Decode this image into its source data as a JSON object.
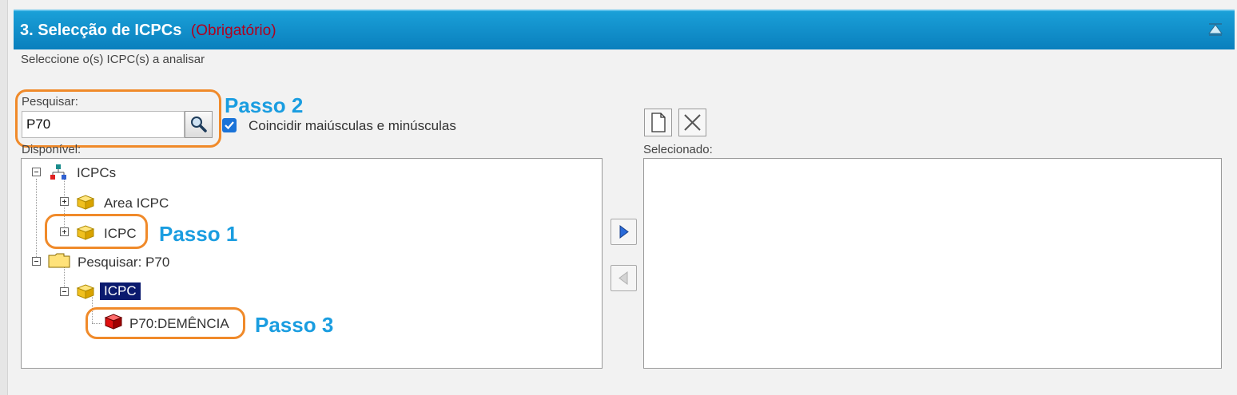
{
  "section": {
    "number": "3.",
    "title": "Selecção de ICPCs",
    "required": "(Obrigatório)",
    "subtitle": "Seleccione o(s) ICPC(s) a analisar"
  },
  "search": {
    "label": "Pesquisar:",
    "value": "P70",
    "match_case_label": "Coincidir maiúsculas e minúsculas",
    "match_case_checked": true
  },
  "available": {
    "label": "Disponível:",
    "tree": [
      {
        "label": "ICPCs",
        "icon": "org-chart-icon"
      },
      {
        "label": "Area ICPC",
        "icon": "cube-icon"
      },
      {
        "label": "ICPC",
        "icon": "cube-icon"
      },
      {
        "label": "Pesquisar: P70",
        "icon": "folder-icon"
      },
      {
        "label": "ICPC",
        "icon": "cube-icon",
        "selected": true
      },
      {
        "label": "P70:DEMÊNCIA",
        "icon": "red-cube-icon"
      }
    ]
  },
  "selected": {
    "label": "Selecionado:"
  },
  "annotations": {
    "step1": "Passo 1",
    "step2": "Passo 2",
    "step3": "Passo 3"
  },
  "colors": {
    "header": "#0a8fcb",
    "required": "#b0001e",
    "annotation_border": "#f08a2a",
    "annotation_text": "#1a9de0",
    "selection": "#0a1a6e"
  }
}
